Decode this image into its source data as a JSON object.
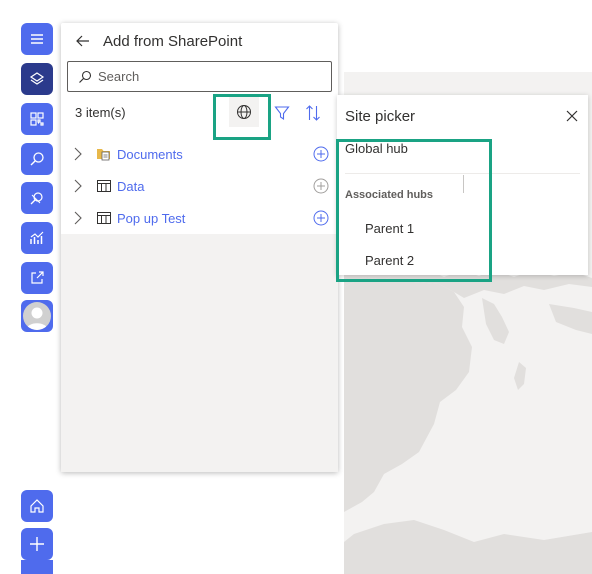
{
  "rail": {
    "buttons": [
      {
        "name": "menu",
        "icon": "hamburger-menu-icon"
      },
      {
        "name": "layers",
        "icon": "layers-icon",
        "active": true
      },
      {
        "name": "qr-code",
        "icon": "qr-code-icon"
      },
      {
        "name": "search",
        "icon": "search-icon"
      },
      {
        "name": "pin",
        "icon": "map-pin-icon"
      },
      {
        "name": "analytics",
        "icon": "analytics-chart-icon"
      },
      {
        "name": "share",
        "icon": "share-icon"
      },
      {
        "name": "home",
        "icon": "home-icon"
      },
      {
        "name": "add",
        "icon": "plus-icon"
      }
    ],
    "color": "#4f6bed",
    "active_color": "#2b3a8c"
  },
  "panel": {
    "title": "Add from SharePoint",
    "search_placeholder": "Search",
    "item_count": "3 item(s)",
    "items": [
      {
        "label": "Documents",
        "icon": "document-library-icon"
      },
      {
        "label": "Data",
        "icon": "list-table-icon"
      },
      {
        "label": "Pop up Test",
        "icon": "list-table-icon"
      }
    ]
  },
  "site_picker": {
    "title": "Site picker",
    "global_hub": "Global hub",
    "associated_hubs_label": "Associated hubs",
    "hubs": [
      "Parent 1",
      "Parent 2"
    ]
  },
  "colors": {
    "accent": "#4f6bed",
    "highlight": "#1aa384",
    "map_land": "#e1dfdd",
    "map_water": "#f3f2f1"
  }
}
